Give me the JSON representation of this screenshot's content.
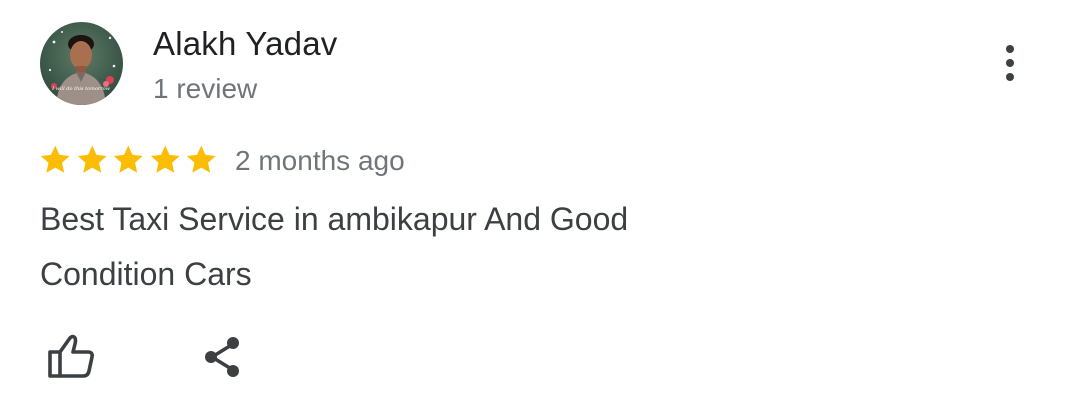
{
  "review": {
    "author_name": "Alakh Yadav",
    "author_meta": "1 review",
    "avatar_caption": "I will do this tomorrow",
    "rating": 5,
    "rating_max": 5,
    "time_ago": "2 months ago",
    "text": "Best Taxi Service in ambikapur And Good Condition Cars"
  },
  "icons": {
    "more": "more-vert-icon",
    "star": "star-icon",
    "like": "thumb-up-icon",
    "share": "share-icon"
  },
  "colors": {
    "star": "#FBBC04",
    "name": "#202124",
    "secondary": "#70757A",
    "body_text": "#3C4043",
    "icon": "#3C4043"
  }
}
